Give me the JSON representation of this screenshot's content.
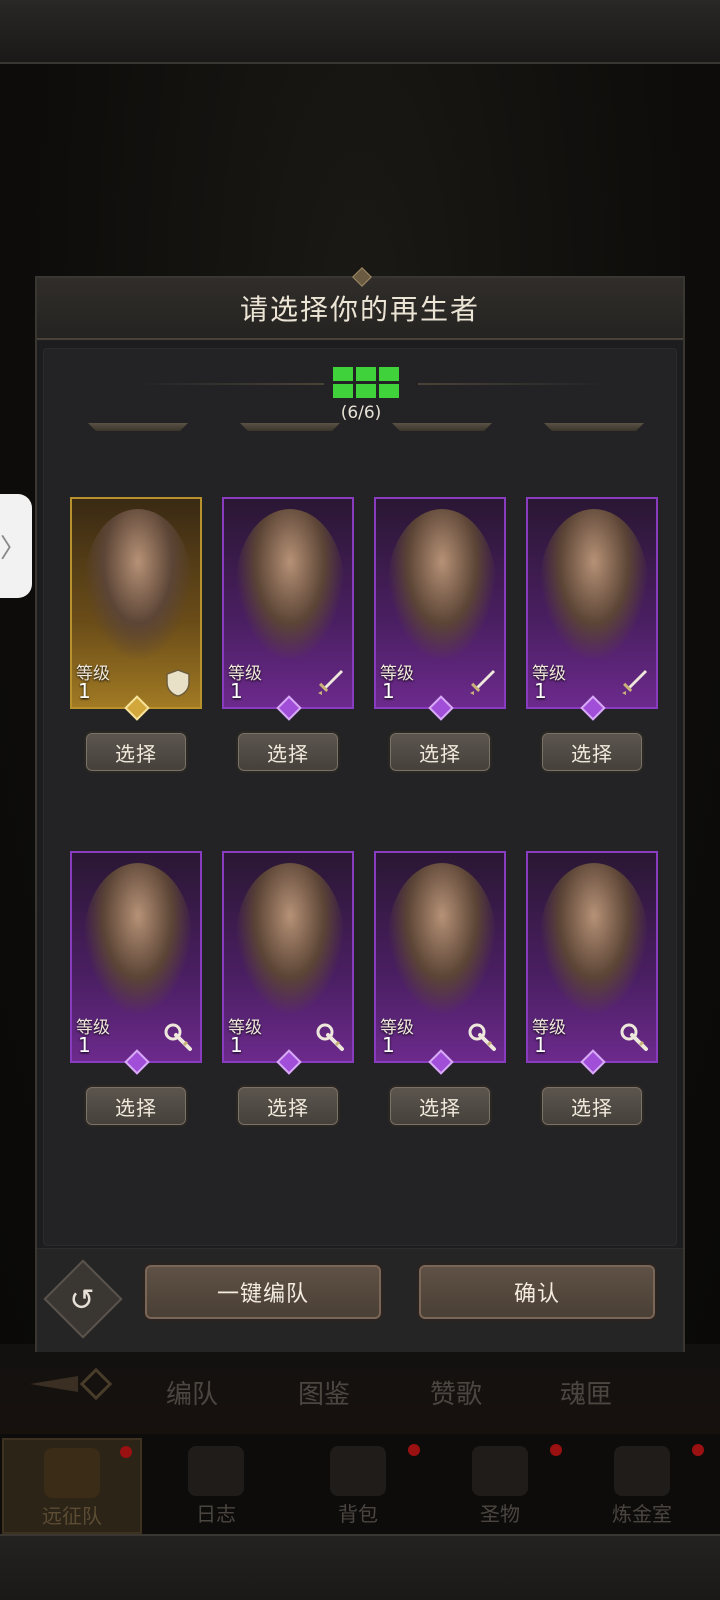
{
  "modal": {
    "title": "请选择你的再生者",
    "counter": "(6/6)",
    "level_label": "等级",
    "select_label": "选择",
    "auto_team_label": "一键编队",
    "confirm_label": "确认"
  },
  "cards": [
    {
      "rarity": "gold",
      "level": "1",
      "class_icon": "shield-icon"
    },
    {
      "rarity": "purple",
      "level": "1",
      "class_icon": "sword-icon"
    },
    {
      "rarity": "purple",
      "level": "1",
      "class_icon": "sword-icon"
    },
    {
      "rarity": "purple",
      "level": "1",
      "class_icon": "sword-icon"
    },
    {
      "rarity": "purple",
      "level": "1",
      "class_icon": "staff-icon"
    },
    {
      "rarity": "purple",
      "level": "1",
      "class_icon": "staff-icon"
    },
    {
      "rarity": "purple",
      "level": "1",
      "class_icon": "staff-icon"
    },
    {
      "rarity": "purple",
      "level": "1",
      "class_icon": "staff-icon"
    }
  ],
  "bottom_tabs": [
    "编队",
    "图鉴",
    "赞歌",
    "魂匣"
  ],
  "nav": [
    "远征队",
    "日志",
    "背包",
    "圣物",
    "炼金室"
  ],
  "colors": {
    "purple_border": "#8a3cc0",
    "gold_border": "#b8902c",
    "counter_green": "#3fd23a",
    "badge_red": "#9b1010"
  }
}
